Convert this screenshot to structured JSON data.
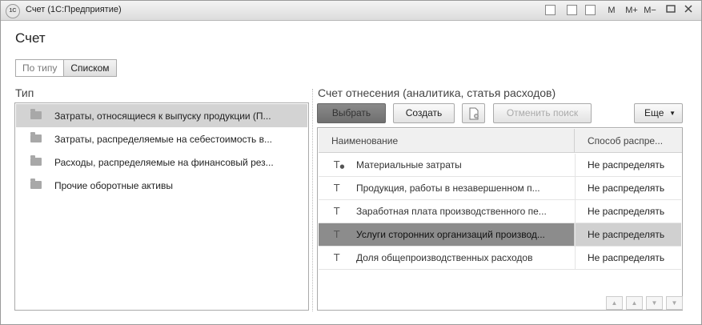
{
  "window": {
    "title": "Счет  (1С:Предприятие)",
    "buttons": {
      "m": "M",
      "m_plus": "M+",
      "m_minus": "M−"
    }
  },
  "form": {
    "title": "Счет",
    "view_toggle": [
      {
        "label": "По типу",
        "active": false
      },
      {
        "label": "Списком",
        "active": true
      }
    ]
  },
  "left": {
    "label": "Тип",
    "items": [
      {
        "label": "Затраты, относящиеся к выпуску продукции (П...",
        "selected": true
      },
      {
        "label": "Затраты, распределяемые на себестоимость в...",
        "selected": false
      },
      {
        "label": "Расходы, распределяемые на финансовый рез...",
        "selected": false
      },
      {
        "label": "Прочие оборотные активы",
        "selected": false
      }
    ]
  },
  "right": {
    "label": "Счет отнесения (аналитика, статья расходов)",
    "toolbar": {
      "select": "Выбрать",
      "create": "Создать",
      "cancel_search": "Отменить поиск",
      "more": "Еще"
    },
    "table": {
      "columns": [
        "Наименование",
        "Способ распре..."
      ],
      "rows": [
        {
          "name": "Материальные затраты",
          "method": "Не распределять",
          "icon": "T-marked",
          "selected": false
        },
        {
          "name": "Продукция, работы в незавершенном п...",
          "method": "Не распределять",
          "icon": "T",
          "selected": false
        },
        {
          "name": "Заработная плата производственного пе...",
          "method": "Не распределять",
          "icon": "T",
          "selected": false
        },
        {
          "name": "Услуги сторонних организаций производ...",
          "method": "Не распределять",
          "icon": "T",
          "selected": true
        },
        {
          "name": "Доля общепроизводственных расходов",
          "method": "Не распределять",
          "icon": "T",
          "selected": false
        }
      ]
    }
  }
}
